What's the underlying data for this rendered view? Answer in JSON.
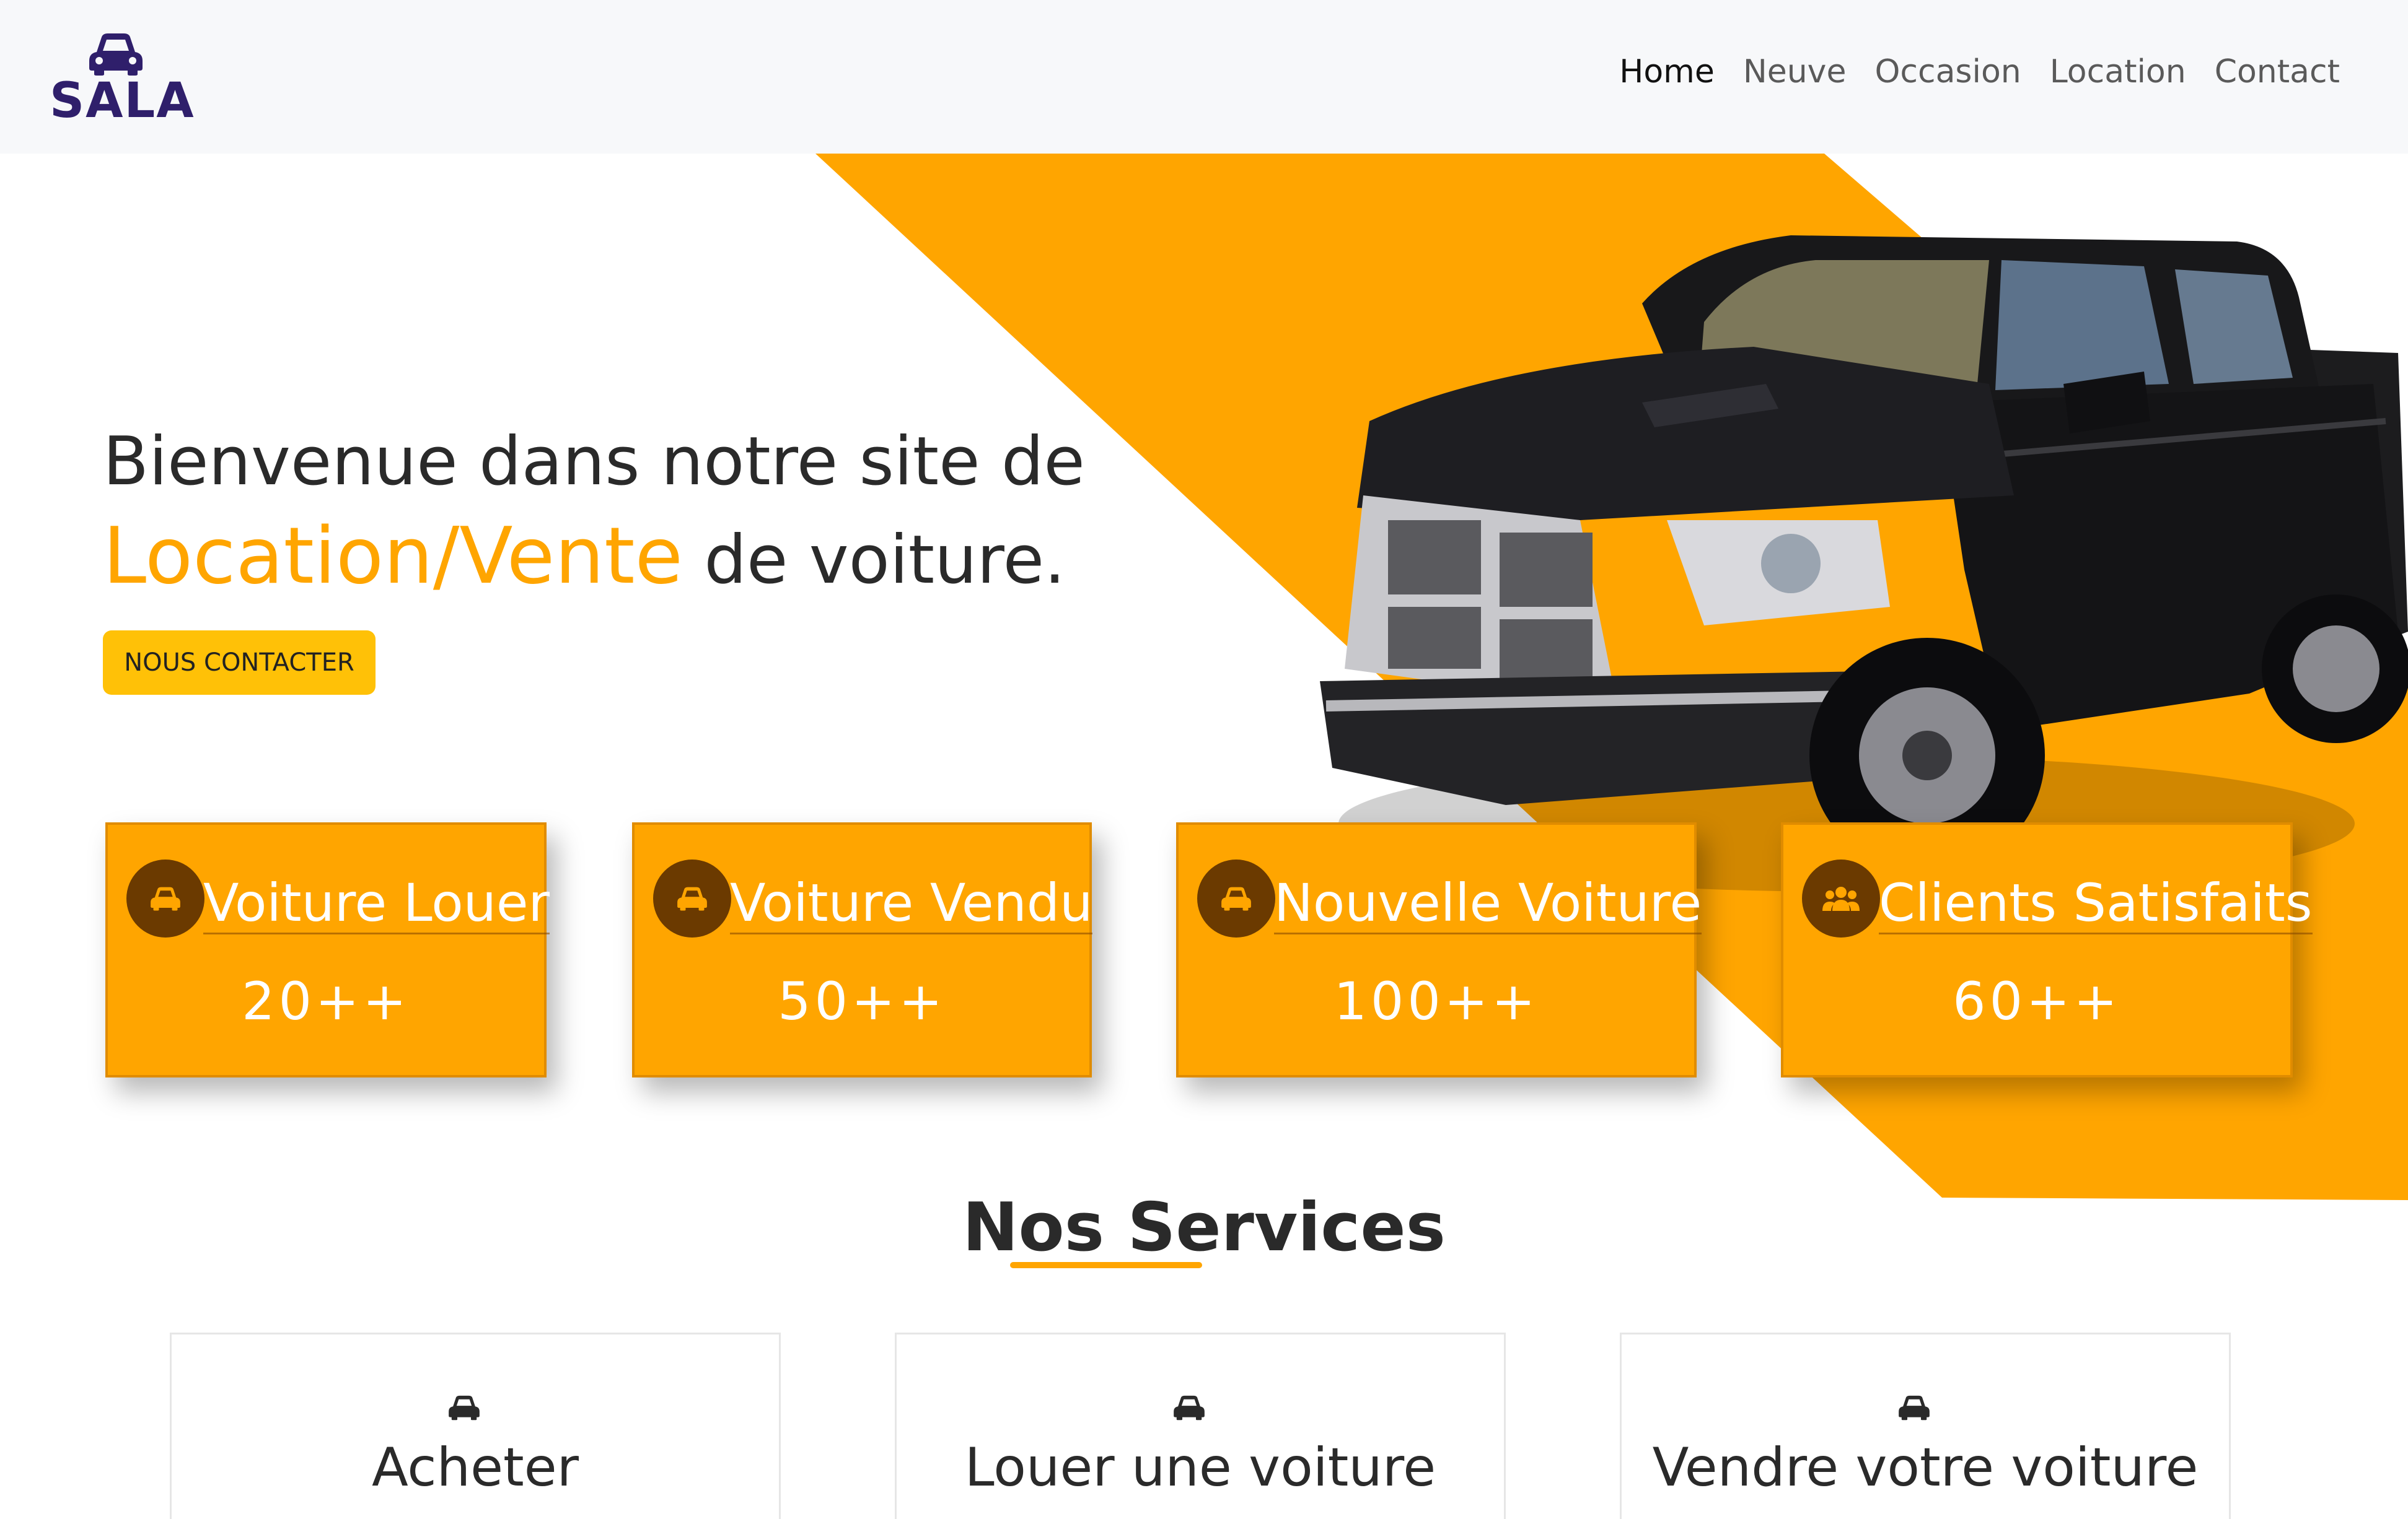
{
  "brand": {
    "name": "SALA",
    "icon": "car-icon",
    "color": "#2f1f6b"
  },
  "nav": {
    "items": [
      {
        "label": "Home",
        "active": true
      },
      {
        "label": "Neuve",
        "active": false
      },
      {
        "label": "Occasion",
        "active": false
      },
      {
        "label": "Location",
        "active": false
      },
      {
        "label": "Contact",
        "active": false
      }
    ]
  },
  "hero": {
    "line1": "Bienvenue dans notre site de",
    "accent": "Location/Vente",
    "line2_rest": " de voiture.",
    "button_label": "NOUS CONTACTER",
    "accent_color": "#ffa500",
    "image": "pickup-truck-image"
  },
  "stats": [
    {
      "label": "Voiture Louer",
      "value": "20++",
      "icon": "car-icon"
    },
    {
      "label": "Voiture Vendu",
      "value": "50++",
      "icon": "car-icon"
    },
    {
      "label": "Nouvelle Voiture",
      "value": "100++",
      "icon": "car-icon"
    },
    {
      "label": "Clients Satisfaits",
      "value": "60++",
      "icon": "users-icon"
    }
  ],
  "services": {
    "title": "Nos Services",
    "cards": [
      {
        "title": "Acheter",
        "icon": "car-icon"
      },
      {
        "title": "Louer une voiture",
        "icon": "car-icon"
      },
      {
        "title": "Vendre votre voiture",
        "icon": "car-icon"
      }
    ]
  },
  "colors": {
    "orange": "#ffa500",
    "button_yellow": "#ffc107",
    "icon_brown": "#6b3a00"
  }
}
